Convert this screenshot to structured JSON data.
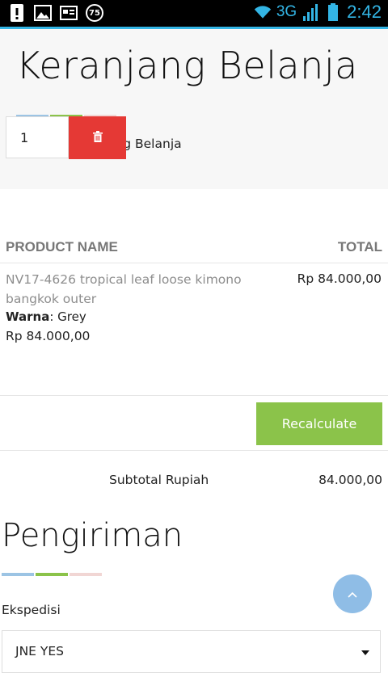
{
  "status_bar": {
    "notification_count": "75",
    "network": "3G",
    "time": "2:42",
    "accent_color": "#33b5e5"
  },
  "header": {
    "title": "Keranjang Belanja",
    "breadcrumb": {
      "home_icon": "home-icon",
      "current": "Keranjang Belanja"
    }
  },
  "cart": {
    "columns": [
      "PRODUCT NAME",
      "TOTAL"
    ],
    "items": [
      {
        "name": "NV17-4626 tropical leaf loose kimono bangkok outer",
        "variant_label": "Warna",
        "variant_value": "Grey",
        "price": "Rp 84.000,00",
        "quantity": "1",
        "total": "Rp 84.000,00"
      }
    ],
    "recalculate_label": "Recalculate",
    "subtotal_label": "Subtotal Rupiah",
    "subtotal_value": "84.000,00"
  },
  "shipping": {
    "title": "Pengiriman",
    "expedition_label": "Ekspedisi",
    "expedition_selected": "JNE YES"
  },
  "colors": {
    "delete": "#e53935",
    "recalculate": "#8bc34a",
    "scroll_top": "#8fbde6",
    "bar_blue": "#9cc4e4",
    "bar_green": "#8bc34a",
    "bar_pink": "#f1d6d4"
  }
}
